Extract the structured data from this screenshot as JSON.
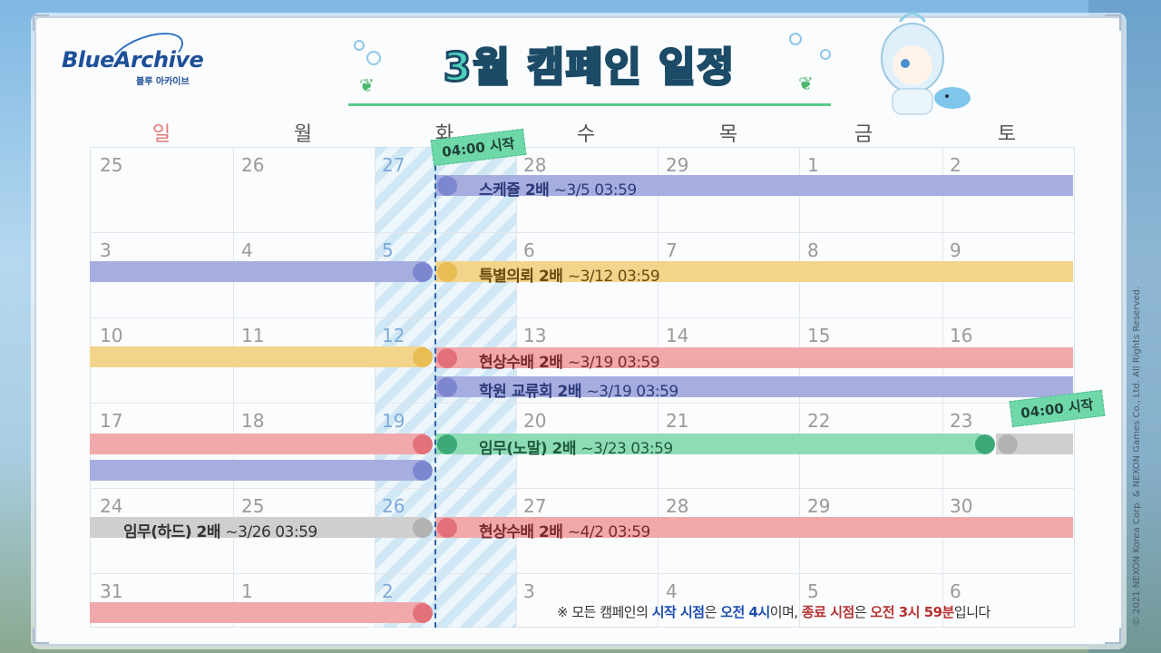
{
  "logo": {
    "main": "BlueArchive",
    "sub": "블루 아카이브"
  },
  "title": "3월 캠페인 일정",
  "weekdays": [
    "일",
    "월",
    "화",
    "수",
    "목",
    "금",
    "토"
  ],
  "colors": {
    "purple": "#a6aee0",
    "purple_dot": "#7d87d0",
    "yellow": "#f2d48a",
    "yellow_dot": "#e8bd54",
    "red": "#f0a8ab",
    "red_dot": "#e2717a",
    "green": "#8edcb6",
    "green_dot": "#3ea978",
    "gray": "#cfcfcf",
    "gray_dot": "#b2b2b2",
    "sunday": "#e27a7a"
  },
  "weeks": [
    [
      "25",
      "26",
      "27",
      "28",
      "29",
      "1",
      "2"
    ],
    [
      "3",
      "4",
      "5",
      "6",
      "7",
      "8",
      "9"
    ],
    [
      "10",
      "11",
      "12",
      "13",
      "14",
      "15",
      "16"
    ],
    [
      "17",
      "18",
      "19",
      "20",
      "21",
      "22",
      "23"
    ],
    [
      "24",
      "25",
      "26",
      "27",
      "28",
      "29",
      "30"
    ],
    [
      "31",
      "1",
      "2",
      "3",
      "4",
      "5",
      "6"
    ]
  ],
  "tags": {
    "start1": "04:00 시작",
    "start2": "04:00 시작"
  },
  "events": {
    "e1": {
      "name": "스케쥴 2배",
      "until": "~3/5 03:59"
    },
    "e2": {
      "name": "특별의뢰 2배",
      "until": "~3/12 03:59"
    },
    "e3": {
      "name": "현상수배 2배",
      "until": "~3/19 03:59"
    },
    "e4": {
      "name": "학원 교류회 2배",
      "until": "~3/19 03:59"
    },
    "e5": {
      "name": "임무(노말) 2배",
      "until": " ~3/23 03:59"
    },
    "e6": {
      "name": "임무(하드) 2배",
      "until": "~3/26 03:59"
    },
    "e7": {
      "name": "현상수배 2배",
      "until": "~4/2 03:59"
    }
  },
  "note": {
    "p1": "※ 모든  캠페인의 ",
    "p2": "시작 시점",
    "p3": "은 ",
    "p4": "오전 4시",
    "p5": "이며, ",
    "p6": "종료 시점",
    "p7": "은 ",
    "p8": "오전 3시 59분",
    "p9": "입니다"
  },
  "copyright": "© 2021 NEXON Korea Corp. & NEXON Games Co., Ltd. All Rights Reserved."
}
